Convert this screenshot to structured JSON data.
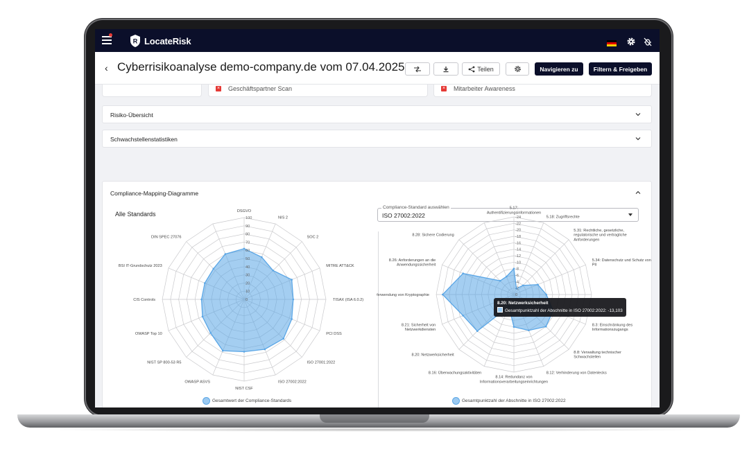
{
  "app": {
    "name": "LocateRisk"
  },
  "header": {
    "title": "Cyberrisikoanalyse demo-company.de vom 07.04.2025",
    "share_label": "Teilen",
    "navigate_label": "Navigieren zu",
    "filter_label": "Filtern & Freigeben",
    "flag_colors": [
      "#000000",
      "#dd0000",
      "#ffce00"
    ]
  },
  "top_cards": [
    {
      "label": "Geschäftspartner Scan"
    },
    {
      "label": "Mitarbeiter Awareness"
    }
  ],
  "sections": {
    "risk_overview": "Risiko-Übersicht",
    "vuln_stats": "Schwachstellenstatistiken",
    "compliance": "Compliance-Mapping-Diagramme"
  },
  "compliance": {
    "left_title": "Alle Standards",
    "select_label": "Compliance-Standard auswählen",
    "select_value": "ISO 27002:2022",
    "left_legend": "Gesamtwert der Compliance-Standards",
    "right_legend": "Gesamtpunktzahl der Abschnitte in ISO 27002:2022",
    "tooltip_title": "8.20: Netzwerksicherheit",
    "tooltip_value": "Gesamtpunktzahl der Abschnitte in ISO 27002:2022: -13,103"
  },
  "chart_data": [
    {
      "type": "radar",
      "series": [
        {
          "name": "Gesamtwert der Compliance-Standards",
          "values": [
            62,
            56,
            50,
            63,
            60,
            63,
            68,
            66,
            64,
            68,
            58,
            55,
            52,
            52,
            53,
            60
          ]
        }
      ],
      "categories": [
        "DSGVO",
        "NIS 2",
        "SOC 2",
        "MITRE ATT&CK",
        "TISAX (ISA 6.0.2)",
        "PCI DSS",
        "ISO 27001:2022",
        "ISO 27002:2022",
        "NIST CSF",
        "OWASP ASVS",
        "NIST SP 800-53 R5",
        "OWASP Top 10",
        "CIS Controls",
        "BSI IT-Grundschutz 2023",
        "DIN SPEC 27076"
      ],
      "ticks": [
        "0",
        "10",
        "20",
        "30",
        "40",
        "50",
        "60",
        "70",
        "80",
        "90",
        "100"
      ],
      "rmin": 0,
      "rmax": 100,
      "color": "#5aa6e6"
    },
    {
      "type": "radar",
      "series": [
        {
          "name": "Gesamtpunktzahl der Abschnitte in ISO 27002:2022",
          "values": [
            -8,
            -2,
            -4,
            -8,
            -10,
            -13.1,
            -14,
            -12,
            -10,
            -4,
            -16,
            -17,
            -22,
            -17,
            -6,
            -6
          ]
        }
      ],
      "categories": [
        "5.17: Authentifizierungsinformationen",
        "5.18: Zugriffsrechte",
        "5.31: Rechtliche, gesetzliche, regulatorische und vertragliche Anforderungen",
        "5.34: Datenschutz und Schutz von PII",
        "",
        "8.3: Einschränkung des Informationszugangs",
        "8.8: Verwaltung technischer Schwachstellen",
        "8.12: Verhinderung von Datenlecks",
        "8.14: Redundanz von Informationsverarbeitungseinrichtungen",
        "8.16: Überwachungsaktivitäten",
        "8.20: Netzwerksicherheit",
        "8.21: Sicherheit von Netzwerkdiensten",
        "8.24: Verwendung von Kryptographie",
        "8.26: Anforderungen an die Anwendungssicherheit",
        "8.28: Sichere Codierung"
      ],
      "ticks": [
        "0",
        "-2",
        "-4",
        "-6",
        "-8",
        "-10",
        "-12",
        "-14",
        "-16",
        "-18",
        "-20",
        "-22",
        "-24"
      ],
      "rmin": -24,
      "rmax": 0,
      "color": "#5aa6e6"
    }
  ]
}
